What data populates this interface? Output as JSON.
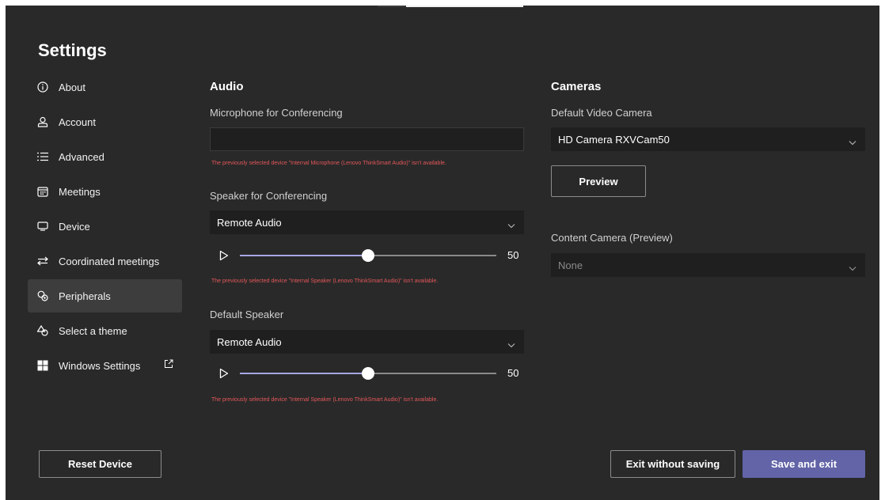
{
  "settings": {
    "title": "Settings"
  },
  "nav": {
    "items": [
      {
        "label": "About",
        "icon": "info-icon"
      },
      {
        "label": "Account",
        "icon": "person-icon"
      },
      {
        "label": "Advanced",
        "icon": "list-icon"
      },
      {
        "label": "Meetings",
        "icon": "calendar-icon"
      },
      {
        "label": "Device",
        "icon": "monitor-icon"
      },
      {
        "label": "Coordinated meetings",
        "icon": "swap-arrows-icon"
      },
      {
        "label": "Peripherals",
        "icon": "peripherals-icon",
        "active": true
      },
      {
        "label": "Select a theme",
        "icon": "shapes-icon"
      },
      {
        "label": "Windows Settings",
        "icon": "windows-logo-icon",
        "external": "open-external-icon"
      }
    ]
  },
  "audio": {
    "title": "Audio",
    "microphone": {
      "label": "Microphone for Conferencing",
      "value": "",
      "error": "The previously selected device \"Internal Microphone (Lenovo ThinkSmart Audio)\" isn't available."
    },
    "speaker": {
      "label": "Speaker for Conferencing",
      "value": "Remote Audio",
      "volume": 50,
      "volume_label": "50",
      "error": "The previously selected device \"Internal Speaker (Lenovo ThinkSmart Audio)\" isn't available."
    },
    "default_speaker": {
      "label": "Default Speaker",
      "value": "Remote Audio",
      "volume": 50,
      "volume_label": "50",
      "error": "The previously selected device \"Internal Speaker (Lenovo ThinkSmart Audio)\" isn't available."
    }
  },
  "cameras": {
    "title": "Cameras",
    "default_camera": {
      "label": "Default Video Camera",
      "value": "HD Camera RXVCam50"
    },
    "preview_label": "Preview",
    "content_camera": {
      "label": "Content Camera (Preview)",
      "value": "None"
    }
  },
  "footer": {
    "reset_label": "Reset Device",
    "exit_label": "Exit without saving",
    "save_label": "Save and exit"
  },
  "colors": {
    "background": "#292929",
    "accent": "#6264a7",
    "error": "#e4575a",
    "slider_fill": "#a7a7e6"
  }
}
